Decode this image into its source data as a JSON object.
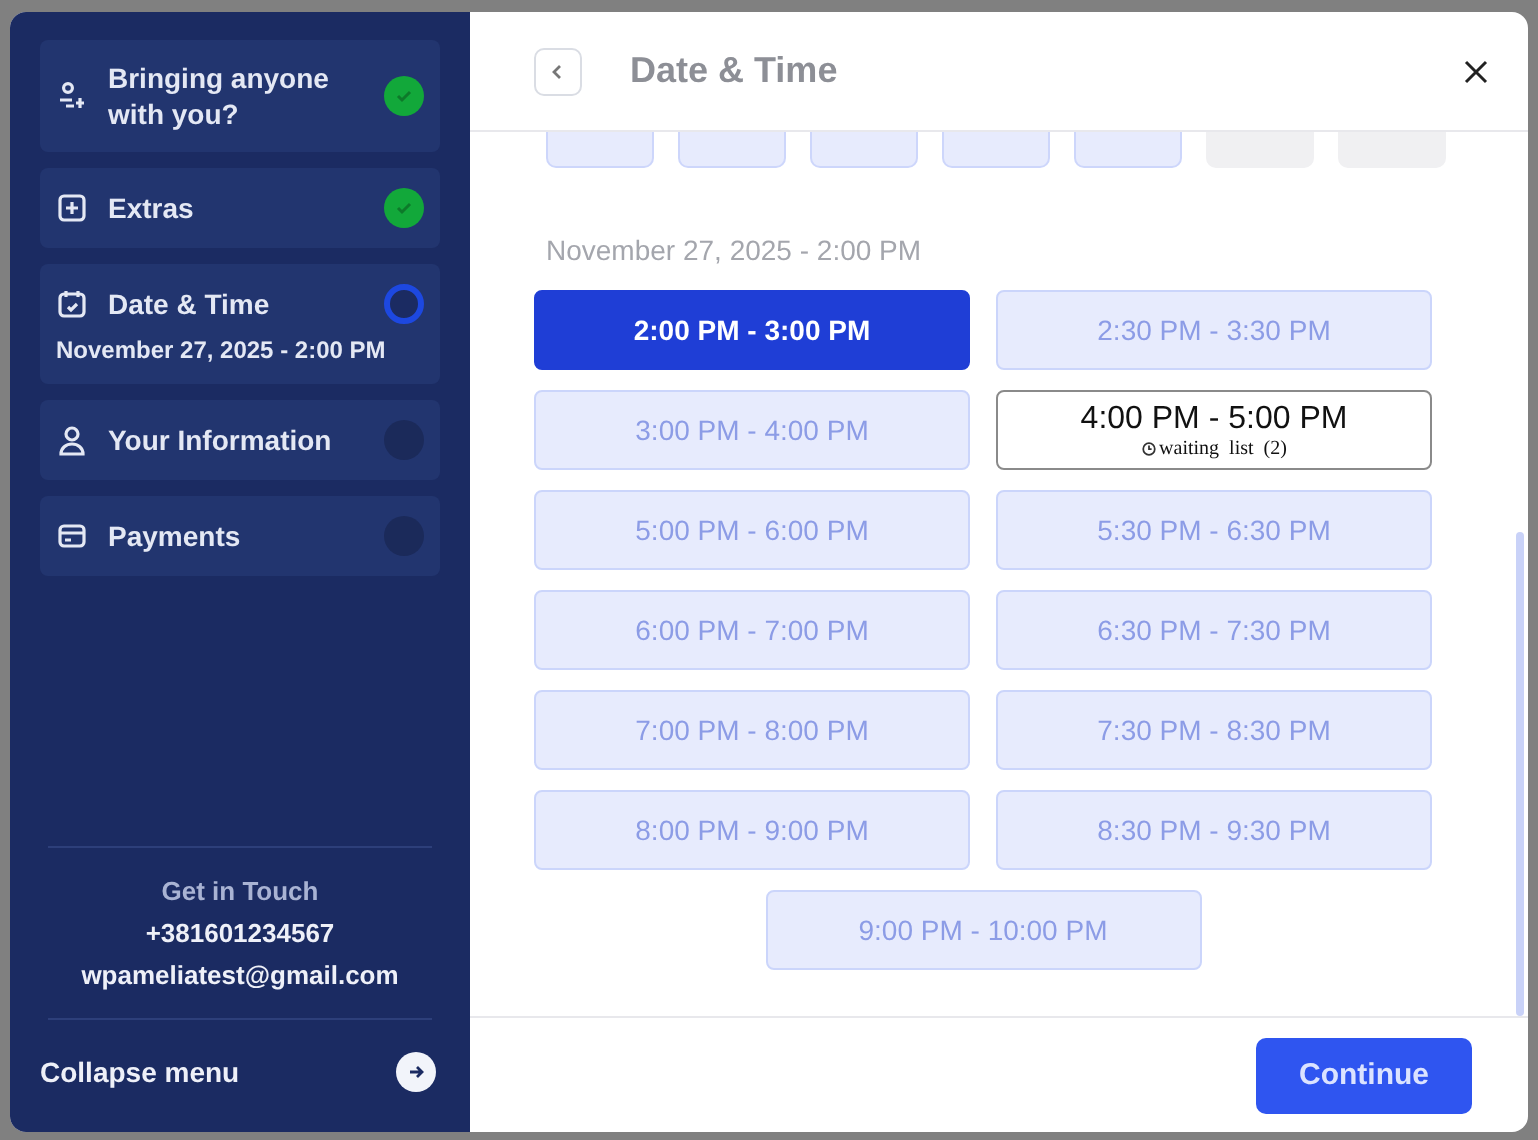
{
  "sidebar": {
    "steps": [
      {
        "label": "Bringing anyone with you?",
        "kind": "done"
      },
      {
        "label": "Extras",
        "kind": "done"
      },
      {
        "label": "Date & Time",
        "kind": "current",
        "detail": "November 27, 2025 - 2:00 PM"
      },
      {
        "label": "Your Information",
        "kind": "pending"
      },
      {
        "label": "Payments",
        "kind": "pending"
      }
    ],
    "contact": {
      "heading": "Get in Touch",
      "phone": "+381601234567",
      "email": "wpameliatest@gmail.com"
    },
    "collapse_label": "Collapse menu"
  },
  "header": {
    "title": "Date & Time"
  },
  "calendar_days": [
    {
      "disabled": false
    },
    {
      "disabled": false
    },
    {
      "disabled": false
    },
    {
      "disabled": false
    },
    {
      "disabled": false
    },
    {
      "disabled": true
    },
    {
      "disabled": true
    }
  ],
  "selected_date": "November 27, 2025 - 2:00 PM",
  "slots": [
    {
      "kind": "available",
      "label": "2:00 PM - 3:00 PM",
      "selected": true
    },
    {
      "kind": "available",
      "label": "2:30 PM - 3:30 PM",
      "selected": false
    },
    {
      "kind": "available",
      "label": "3:00 PM - 4:00 PM",
      "selected": false
    },
    {
      "kind": "waitlist",
      "label": "4:00 PM - 5:00 PM",
      "note": "waiting  list  (2)",
      "selected": false
    },
    {
      "kind": "available",
      "label": "5:00 PM - 6:00 PM",
      "selected": false
    },
    {
      "kind": "available",
      "label": "5:30 PM - 6:30 PM",
      "selected": false
    },
    {
      "kind": "available",
      "label": "6:00 PM - 7:00 PM",
      "selected": false
    },
    {
      "kind": "available",
      "label": "6:30 PM - 7:30 PM",
      "selected": false
    },
    {
      "kind": "available",
      "label": "7:00 PM - 8:00 PM",
      "selected": false
    },
    {
      "kind": "available",
      "label": "7:30 PM - 8:30 PM",
      "selected": false
    },
    {
      "kind": "available",
      "label": "8:00 PM - 9:00 PM",
      "selected": false
    },
    {
      "kind": "available",
      "label": "8:30 PM - 9:30 PM",
      "selected": false
    },
    {
      "kind": "available",
      "label": "9:00 PM - 10:00 PM",
      "selected": false
    }
  ],
  "footer": {
    "continue_label": "Continue"
  }
}
